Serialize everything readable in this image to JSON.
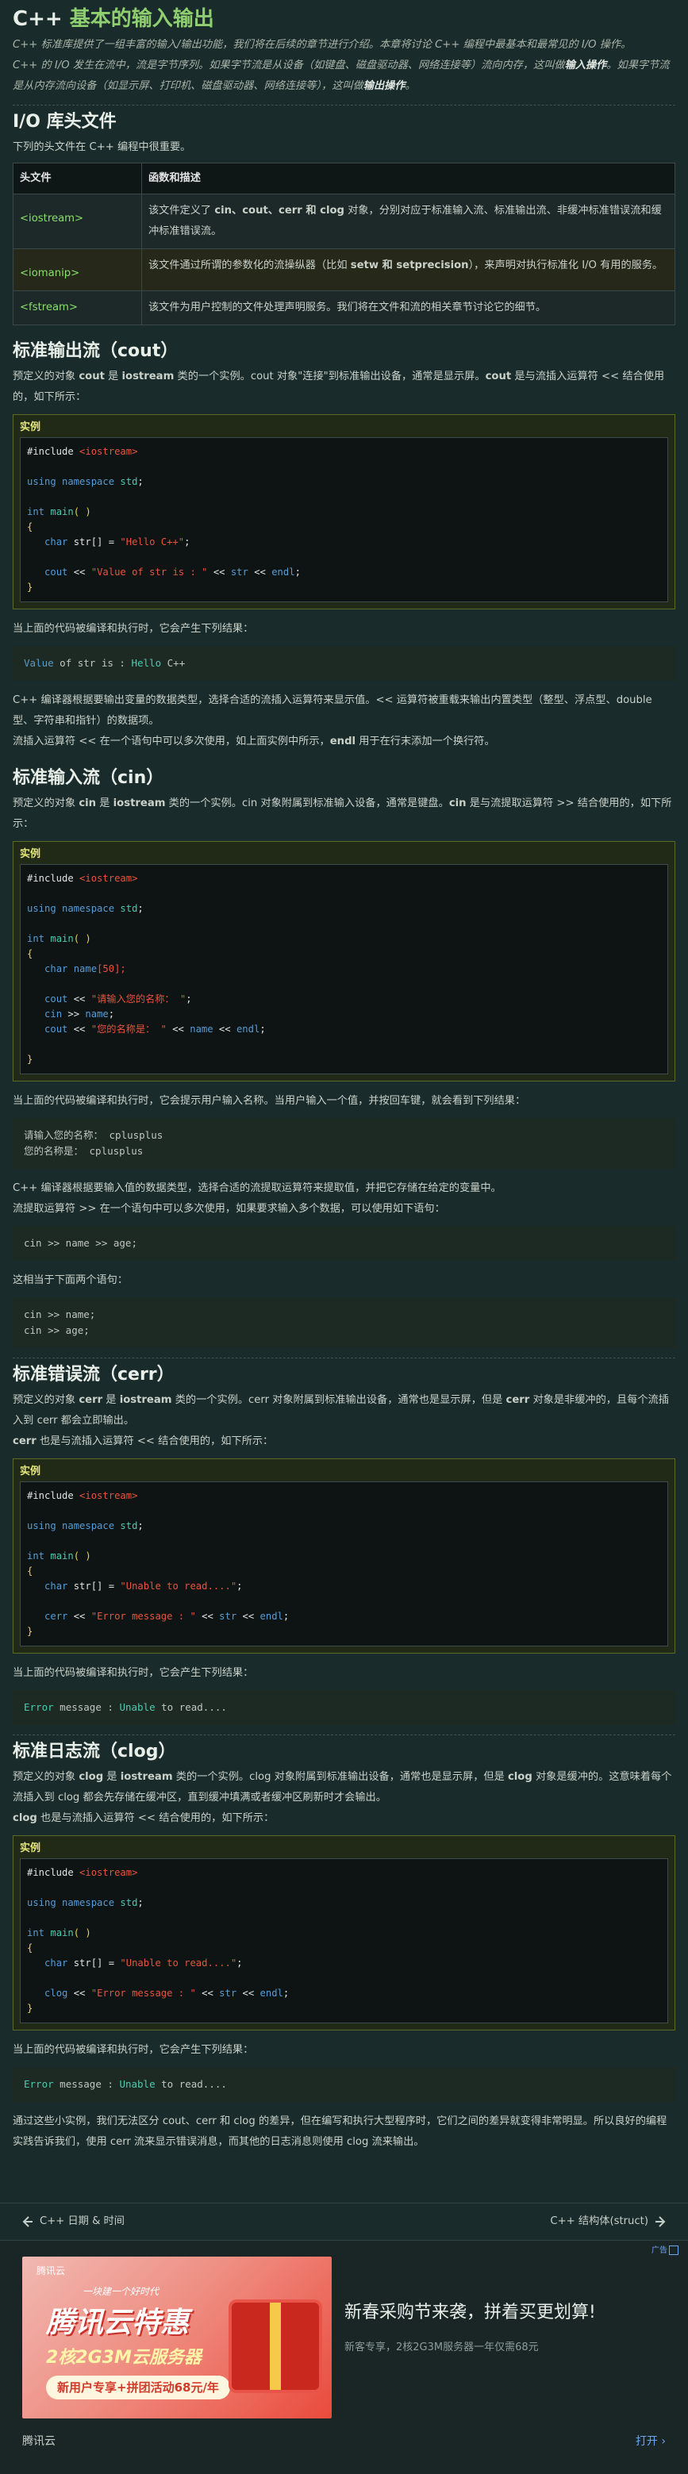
{
  "page_title_prefix": "C++ ",
  "page_title_main": "基本的输入输出",
  "intro": {
    "p1": "C++ 标准库提供了一组丰富的输入/输出功能，我们将在后续的章节进行介绍。本章将讨论 C++ 编程中最基本和最常见的 I/O 操作。",
    "p2a": "C++ 的 I/O 发生在流中，流是字节序列。如果字节流是从设备（如键盘、磁盘驱动器、网络连接等）流向内存，这叫做",
    "p2b": "输入操作",
    "p2c": "。如果字节流是从内存流向设备（如显示屏、打印机、磁盘驱动器、网络连接等），这叫做",
    "p2d": "输出操作",
    "p2e": "。"
  },
  "io_headers": {
    "title": "I/O 库头文件",
    "desc": "下列的头文件在 C++ 编程中很重要。",
    "col1": "头文件",
    "col2": "函数和描述",
    "rows": [
      {
        "header": "<iostream>",
        "desc_a": "该文件定义了 ",
        "desc_b": "cin、cout、cerr 和 clog",
        "desc_c": " 对象，分别对应于标准输入流、标准输出流、非缓冲标准错误流和缓冲标准错误流。"
      },
      {
        "header": "<iomanip>",
        "desc_a": "该文件通过所谓的参数化的流操纵器（比如 ",
        "desc_b": "setw 和 setprecision",
        "desc_c": "），来声明对执行标准化 I/O 有用的服务。"
      },
      {
        "header": "<fstream>",
        "desc_a": "该文件为用户控制的文件处理声明服务。我们将在文件和流的相关章节讨论它的细节。",
        "desc_b": "",
        "desc_c": ""
      }
    ]
  },
  "cout_section": {
    "title": "标准输出流（cout）",
    "p_a": "预定义的对象 ",
    "p_b": "cout",
    "p_c": " 是 ",
    "p_d": "iostream",
    "p_e": " 类的一个实例。cout 对象\"连接\"到标准输出设备，通常是显示屏。",
    "p_f": "cout",
    "p_g": " 是与流插入运算符 << 结合使用的，如下所示：",
    "example_label": "实例",
    "run_text": "当上面的代码被编译和执行时，它会产生下列结果：",
    "output_a": "Value",
    "output_b": " of str is : ",
    "output_c": "Hello",
    "output_d": " C++",
    "after1": "C++ 编译器根据要输出变量的数据类型，选择合适的流插入运算符来显示值。<< 运算符被重载来输出内置类型（整型、浮点型、double 型、字符串和指针）的数据项。",
    "after2a": "流插入运算符 << 在一个语句中可以多次使用，如上面实例中所示，",
    "after2b": "endl",
    "after2c": " 用于在行末添加一个换行符。"
  },
  "cin_section": {
    "title": "标准输入流（cin）",
    "p_a": "预定义的对象 ",
    "p_b": "cin",
    "p_c": " 是 ",
    "p_d": "iostream",
    "p_e": " 类的一个实例。cin 对象附属到标准输入设备，通常是键盘。",
    "p_f": "cin",
    "p_g": " 是与流提取运算符 >> 结合使用的，如下所示：",
    "example_label": "实例",
    "run_text": "当上面的代码被编译和执行时，它会提示用户输入名称。当用户输入一个值，并按回车键，就会看到下列结果：",
    "output": "请输入您的名称： cplusplus\n您的名称是： cplusplus",
    "after1": "C++ 编译器根据要输入值的数据类型，选择合适的流提取运算符来提取值，并把它存储在给定的变量中。",
    "after2": "流提取运算符 >> 在一个语句中可以多次使用，如果要求输入多个数据，可以使用如下语句：",
    "stmt1": "cin >> name >> age;",
    "equiv": "这相当于下面两个语句：",
    "stmt2": "cin >> name;\ncin >> age;"
  },
  "cerr_section": {
    "title": "标准错误流（cerr）",
    "p_a": "预定义的对象 ",
    "p_b": "cerr",
    "p_c": " 是 ",
    "p_d": "iostream",
    "p_e": " 类的一个实例。cerr 对象附属到标准输出设备，通常也是显示屏，但是 ",
    "p_f": "cerr",
    "p_g": " 对象是非缓冲的，且每个流插入到 cerr 都会立即输出。",
    "p2a": "cerr",
    "p2b": " 也是与流插入运算符 << 结合使用的，如下所示：",
    "example_label": "实例",
    "run_text": "当上面的代码被编译和执行时，它会产生下列结果：",
    "output_a": "Error",
    "output_b": " message : ",
    "output_c": "Unable",
    "output_d": " to read...."
  },
  "clog_section": {
    "title": "标准日志流（clog）",
    "p_a": "预定义的对象 ",
    "p_b": "clog",
    "p_c": " 是 ",
    "p_d": "iostream",
    "p_e": " 类的一个实例。clog 对象附属到标准输出设备，通常也是显示屏，但是 ",
    "p_f": "clog",
    "p_g": " 对象是缓冲的。这意味着每个流插入到 clog 都会先存储在缓冲区，直到缓冲填满或者缓冲区刷新时才会输出。",
    "p2a": "clog",
    "p2b": " 也是与流插入运算符 << 结合使用的，如下所示：",
    "example_label": "实例",
    "run_text": "当上面的代码被编译和执行时，它会产生下列结果：",
    "output_a": "Error",
    "output_b": " message : ",
    "output_c": "Unable",
    "output_d": " to read....",
    "closing": "通过这些小实例，我们无法区分 cout、cerr 和 clog 的差异，但在编写和执行大型程序时，它们之间的差异就变得非常明显。所以良好的编程实践告诉我们，使用 cerr 流来显示错误消息，而其他的日志消息则使用 clog 流来输出。"
  },
  "code": {
    "include": "#include ",
    "iostream": "<iostream>",
    "using": "using",
    "namespace": " namespace ",
    "std": "std",
    "semi": ";",
    "int": "int",
    "main": " main",
    "parens": "( )",
    "open": "{",
    "close": "}",
    "char": "char",
    "cout": "cout",
    "cin": "cin",
    "cerr": "cerr",
    "clog": "clog",
    "endl": "endl",
    "cout_str_decl": " str[] = ",
    "cout_str_val": "\"Hello C++\"",
    "cout_line": " << ",
    "cout_lit": "\"Value of str is : \"",
    "str": "str",
    "name": "name",
    "name_decl": "[50];",
    "cin_lit1": "\"请输入您的名称： \"",
    "cin_op": " >> ",
    "cin_lit2": "\"您的名称是： \"",
    "err_val": "\"Unable to read....\"",
    "err_lit": "\"Error message : \""
  },
  "nav": {
    "prev": "C++ 日期 & 时间",
    "next": "C++ 结构体(struct)"
  },
  "ad": {
    "tag": "广告",
    "brand": "腾讯云",
    "logo": "腾讯云",
    "slogan": "一块建一个好时代",
    "big": "腾讯云特惠",
    "mid": "2核2G3M云服务器",
    "pill": "新用户专享+拼团活动68元/年",
    "headline": "新春采购节来袭，拼着买更划算!",
    "sub": "新客专享，2核2G3M服务器一年仅需68元",
    "open": "打开"
  }
}
